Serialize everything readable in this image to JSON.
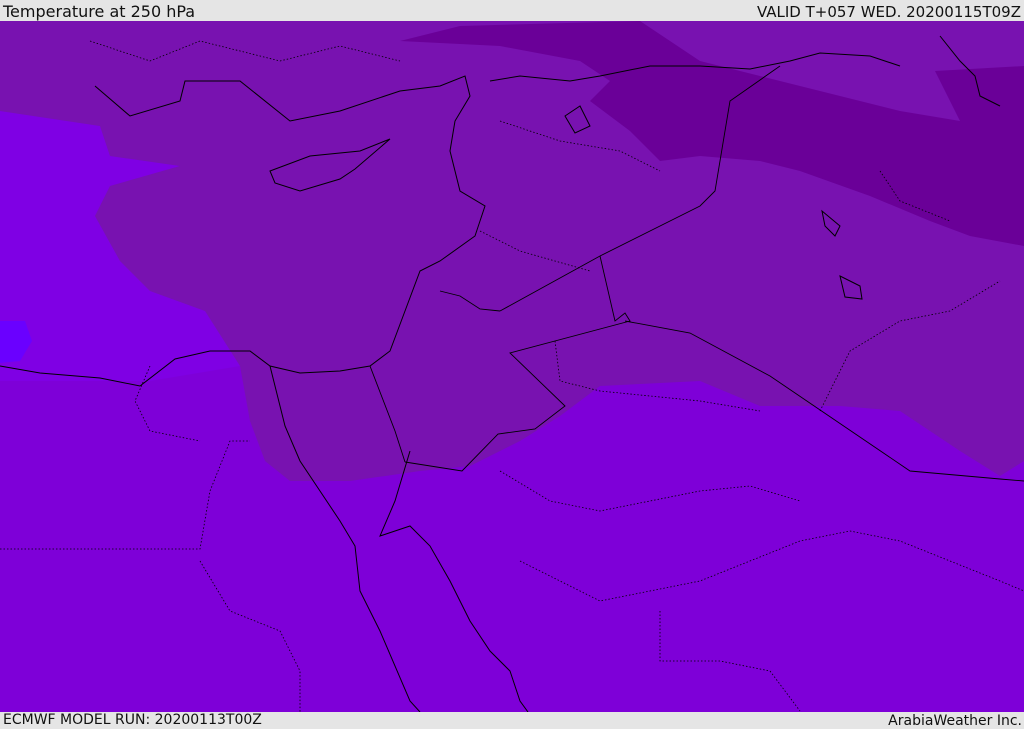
{
  "header": {
    "title": "Temperature at 250 hPa",
    "valid": "VALID T+057 WED. 20200115T09Z"
  },
  "footer": {
    "model_run": "ECMWF MODEL RUN: 20200113T00Z",
    "credit": "ArabiaWeather Inc."
  },
  "colors": {
    "base": "#7e00d8",
    "warmer_band": "#7812b0",
    "cold_core": "#6a0098",
    "west_sea": "#7f00e4",
    "edge_patch": "#6a00ff",
    "coast": "#000000"
  }
}
